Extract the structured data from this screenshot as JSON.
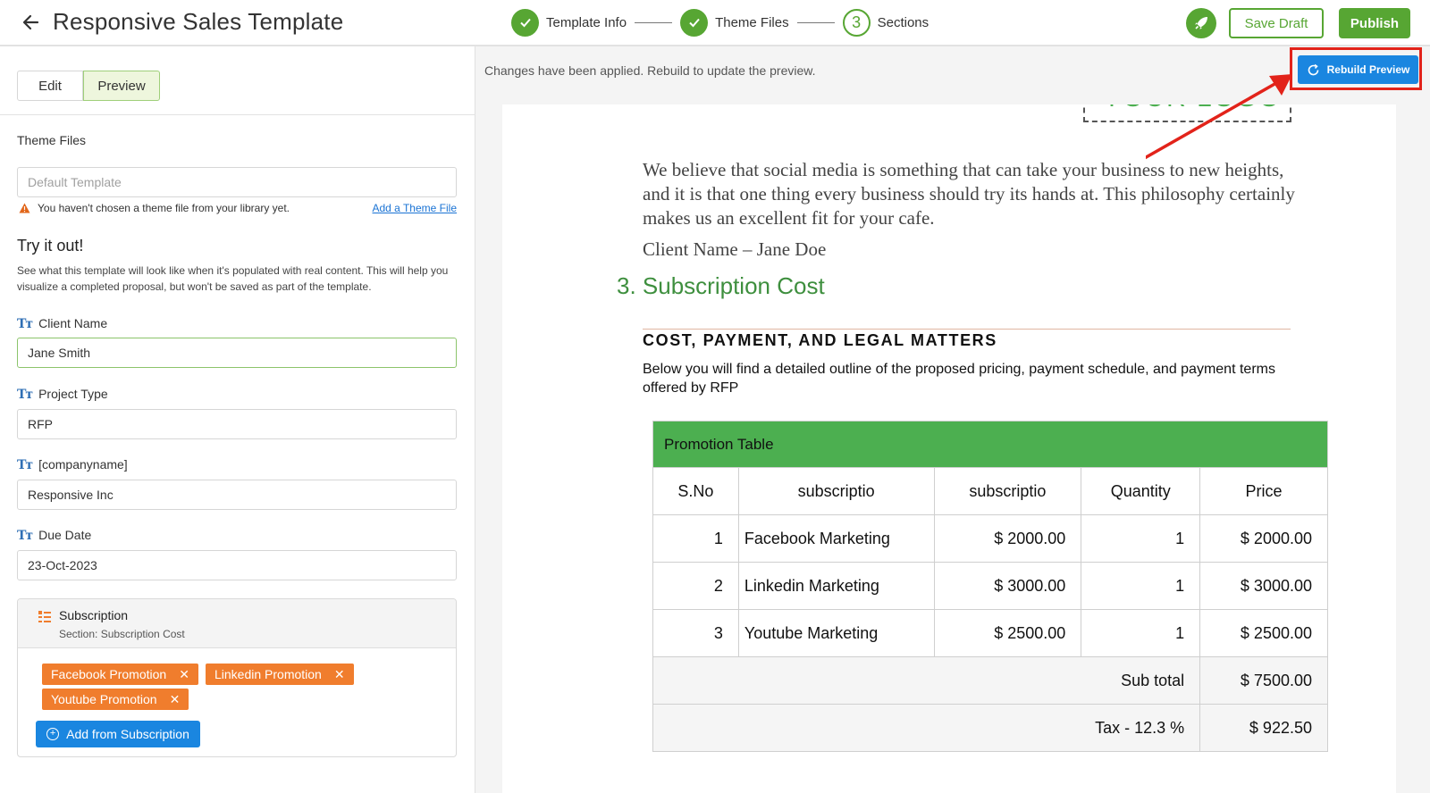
{
  "header": {
    "title": "Responsive Sales Template",
    "steps": [
      {
        "label": "Template Info",
        "state": "done"
      },
      {
        "label": "Theme Files",
        "state": "done"
      },
      {
        "label": "Sections",
        "state": "current",
        "number": "3"
      }
    ],
    "save_draft": "Save Draft",
    "publish": "Publish",
    "accent_color": "#57a633"
  },
  "left": {
    "tabs": [
      {
        "label": "Edit",
        "active": false
      },
      {
        "label": "Preview",
        "active": true
      }
    ],
    "theme_files_label": "Theme Files",
    "theme_placeholder": "Default Template",
    "warning_text": "You haven't chosen a theme file from your library yet.",
    "add_theme_link": "Add a Theme File",
    "try_title": "Try it out!",
    "try_desc": "See what this template will look like when it's populated with real content. This will help you visualize a completed proposal, but won't be saved as part of the template.",
    "fields": [
      {
        "label": "Client Name",
        "value": "Jane Smith"
      },
      {
        "label": "Project Type",
        "value": "RFP"
      },
      {
        "label": "[companyname]",
        "value": "Responsive Inc"
      },
      {
        "label": "Due Date",
        "value": "23-Oct-2023"
      }
    ],
    "subscription": {
      "title": "Subscription",
      "subtitle": "Section: Subscription Cost",
      "chips": [
        "Facebook Promotion",
        "Linkedin Promotion",
        "Youtube Promotion"
      ],
      "add_button": "Add from Subscription"
    }
  },
  "preview": {
    "notice": "Changes have been applied. Rebuild to update the preview.",
    "rebuild_button": "Rebuild Preview",
    "logo_text": "YOUR LOGO",
    "quote": "We believe that social media is something that can take your business to new heights, and it is that one thing every business should try its hands at. This philosophy certainly makes us an excellent fit for your cafe.",
    "client_line": "Client Name – Jane Doe",
    "section_heading": "3. Subscription Cost",
    "cpl_heading": "COST, PAYMENT, AND LEGAL MATTERS",
    "cpl_desc": " Below you will find a detailed outline of the proposed pricing, payment schedule, and payment terms offered by RFP",
    "table": {
      "title": "Promotion Table",
      "headers": [
        "S.No",
        "subscriptio",
        "subscriptio",
        "Quantity",
        "Price"
      ],
      "rows": [
        {
          "sno": "1",
          "name": "Facebook Marketing",
          "unit": "$ 2000.00",
          "qty": "1",
          "price": "$ 2000.00"
        },
        {
          "sno": "2",
          "name": "Linkedin Marketing",
          "unit": "$ 3000.00",
          "qty": "1",
          "price": "$ 3000.00"
        },
        {
          "sno": "3",
          "name": "Youtube Marketing",
          "unit": "$ 2500.00",
          "qty": "1",
          "price": "$ 2500.00"
        }
      ],
      "subtotal_label": "Sub total",
      "subtotal_value": "$ 7500.00",
      "tax_label": "Tax - 12.3 %",
      "tax_value": "$ 922.50"
    }
  }
}
